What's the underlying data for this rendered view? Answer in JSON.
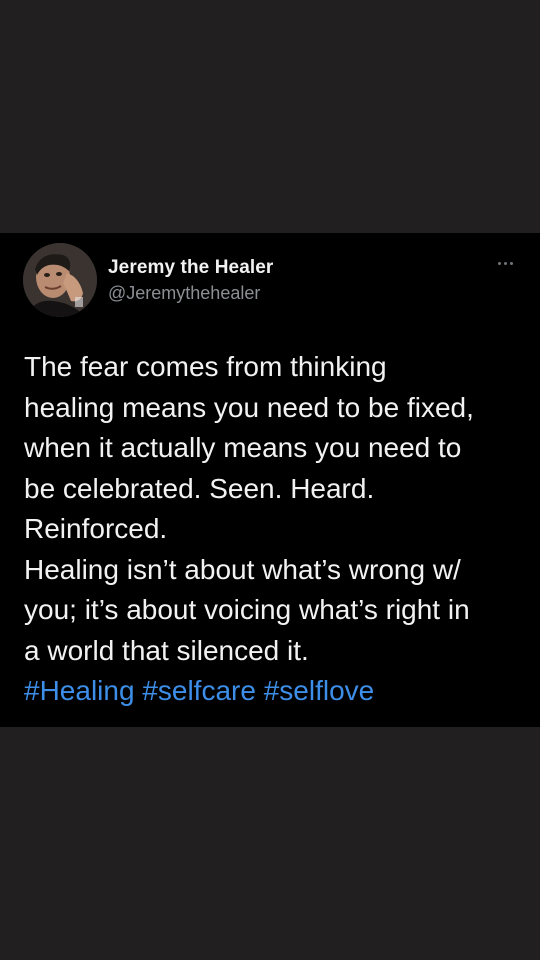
{
  "author": {
    "display_name": "Jeremy the Healer",
    "handle": "@Jeremythehealer"
  },
  "more_icon": "more-horizontal-icon",
  "tweet": {
    "lines": [
      "The fear comes from thinking",
      "healing means you need to be fixed,",
      "when it actually means you need to",
      "be celebrated. Seen. Heard.",
      "Reinforced.",
      "Healing isn’t about what’s wrong w/",
      "you; it’s about voicing what’s right in",
      "a world that silenced it."
    ],
    "hashtags": [
      "#Healing",
      "#selfcare",
      "#selflove"
    ]
  },
  "colors": {
    "page_background": "#221f20",
    "card_background": "#000000",
    "text": "#f2f2f2",
    "handle": "#8b8f94",
    "hashtag": "#3d8ee8"
  }
}
